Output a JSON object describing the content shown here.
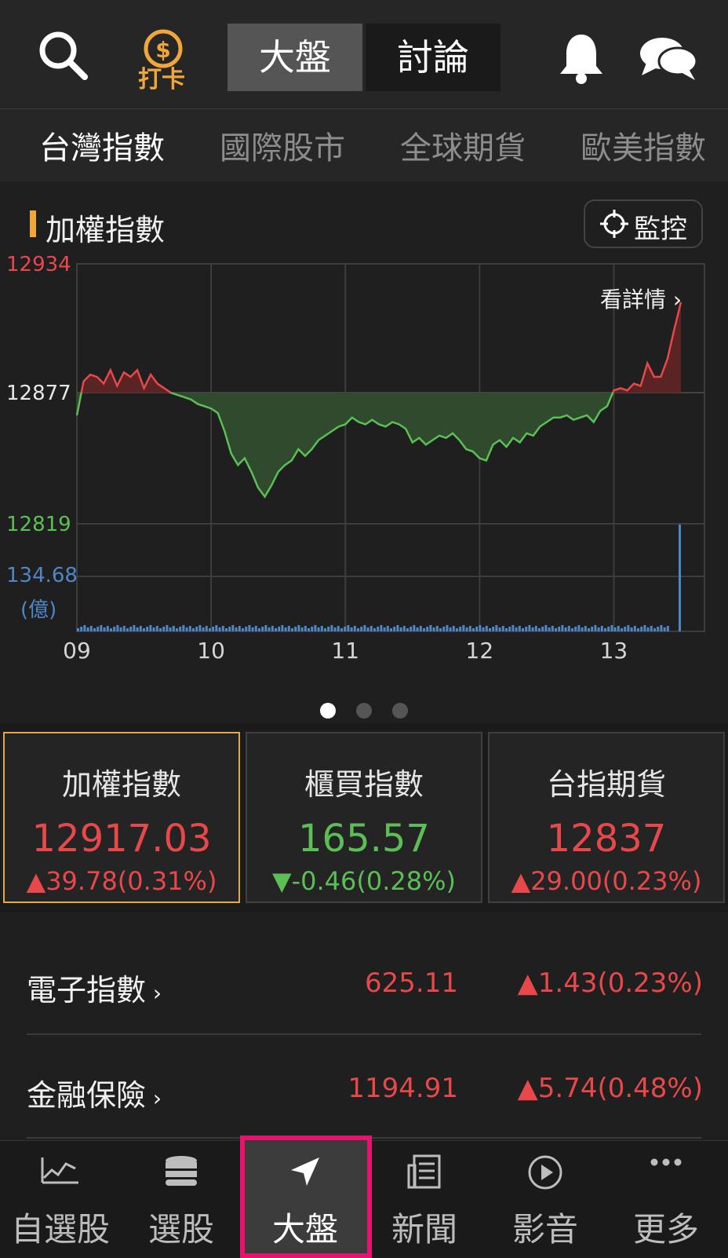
{
  "header": {
    "segments": [
      "大盤",
      "討論"
    ],
    "checkin_badge_text": "打卡"
  },
  "subnav": {
    "tabs": [
      "台灣指數",
      "國際股市",
      "全球期貨",
      "歐美指數"
    ],
    "active": 0
  },
  "chart_section": {
    "title": "加權指數",
    "monitor_label": "監控",
    "details_link": "看詳情",
    "volume_label": "134.68",
    "volume_unit": "(億)"
  },
  "chart_data": {
    "type": "area",
    "y_ticks": [
      "12934",
      "12877",
      "12819"
    ],
    "ylim": [
      12819,
      12934
    ],
    "reference_value": 12877,
    "x_ticks": [
      "09",
      "10",
      "11",
      "12",
      "13"
    ],
    "x_range": [
      9.0,
      13.5
    ],
    "series": [
      {
        "x": [
          9.0,
          9.05,
          9.1,
          9.15,
          9.2,
          9.25,
          9.3,
          9.35,
          9.4,
          9.45,
          9.5,
          9.55,
          9.6,
          9.65,
          9.7,
          9.75,
          9.8,
          9.85,
          9.9,
          9.95,
          10.0,
          10.05,
          10.1,
          10.15,
          10.2,
          10.25,
          10.3,
          10.35,
          10.4,
          10.45,
          10.5,
          10.55,
          10.6,
          10.65,
          10.7,
          10.75,
          10.8,
          10.85,
          10.9,
          10.95,
          11.0,
          11.05,
          11.1,
          11.15,
          11.2,
          11.25,
          11.3,
          11.35,
          11.4,
          11.45,
          11.5,
          11.55,
          11.6,
          11.65,
          11.7,
          11.75,
          11.8,
          11.85,
          11.9,
          11.95,
          12.0,
          12.05,
          12.1,
          12.15,
          12.2,
          12.25,
          12.3,
          12.35,
          12.4,
          12.45,
          12.5,
          12.55,
          12.6,
          12.65,
          12.7,
          12.75,
          12.8,
          12.85,
          12.9,
          12.95,
          13.0,
          13.05,
          13.1,
          13.15,
          13.2,
          13.25,
          13.3,
          13.35,
          13.4,
          13.45,
          13.5
        ],
        "y": [
          12867,
          12882,
          12885,
          12884,
          12881,
          12887,
          12880,
          12886,
          12884,
          12887,
          12879,
          12885,
          12881,
          12879,
          12877,
          12876,
          12875,
          12874,
          12872,
          12871,
          12870,
          12868,
          12860,
          12850,
          12845,
          12848,
          12842,
          12835,
          12831,
          12836,
          12842,
          12845,
          12847,
          12852,
          12849,
          12852,
          12856,
          12858,
          12860,
          12862,
          12863,
          12866,
          12864,
          12863,
          12865,
          12863,
          12862,
          12864,
          12863,
          12861,
          12855,
          12857,
          12854,
          12856,
          12858,
          12857,
          12859,
          12856,
          12852,
          12851,
          12848,
          12847,
          12854,
          12856,
          12853,
          12857,
          12855,
          12859,
          12858,
          12862,
          12864,
          12866,
          12866,
          12867,
          12865,
          12866,
          12867,
          12864,
          12869,
          12871,
          12878,
          12879,
          12878,
          12881,
          12880,
          12890,
          12884,
          12884,
          12892,
          12905,
          12917
        ]
      }
    ],
    "volume_max": 134.68,
    "grid": true
  },
  "pager": {
    "count": 3,
    "active": 0
  },
  "cards": [
    {
      "title": "加權指數",
      "value": "12917.03",
      "change": "▲39.78(0.31%)",
      "direction": "up"
    },
    {
      "title": "櫃買指數",
      "value": "165.57",
      "change": "▼-0.46(0.28%)",
      "direction": "down"
    },
    {
      "title": "台指期貨",
      "value": "12837",
      "change": "▲29.00(0.23%)",
      "direction": "up"
    }
  ],
  "list": [
    {
      "name": "電子指數",
      "value": "625.11",
      "change": "▲1.43(0.23%)"
    },
    {
      "name": "金融保險",
      "value": "1194.91",
      "change": "▲5.74(0.48%)"
    }
  ],
  "bottom_nav": [
    {
      "label": "自選股",
      "icon": "chart-line-icon"
    },
    {
      "label": "選股",
      "icon": "coins-stack-icon"
    },
    {
      "label": "大盤",
      "icon": "navigation-arrow-icon"
    },
    {
      "label": "新聞",
      "icon": "newspaper-icon"
    },
    {
      "label": "影音",
      "icon": "play-circle-icon"
    },
    {
      "label": "更多",
      "icon": "more-dots-icon"
    }
  ],
  "colors": {
    "up": "#e8484a",
    "down": "#5bbf56",
    "accent": "#f0a73a",
    "highlight": "#e6146e"
  }
}
